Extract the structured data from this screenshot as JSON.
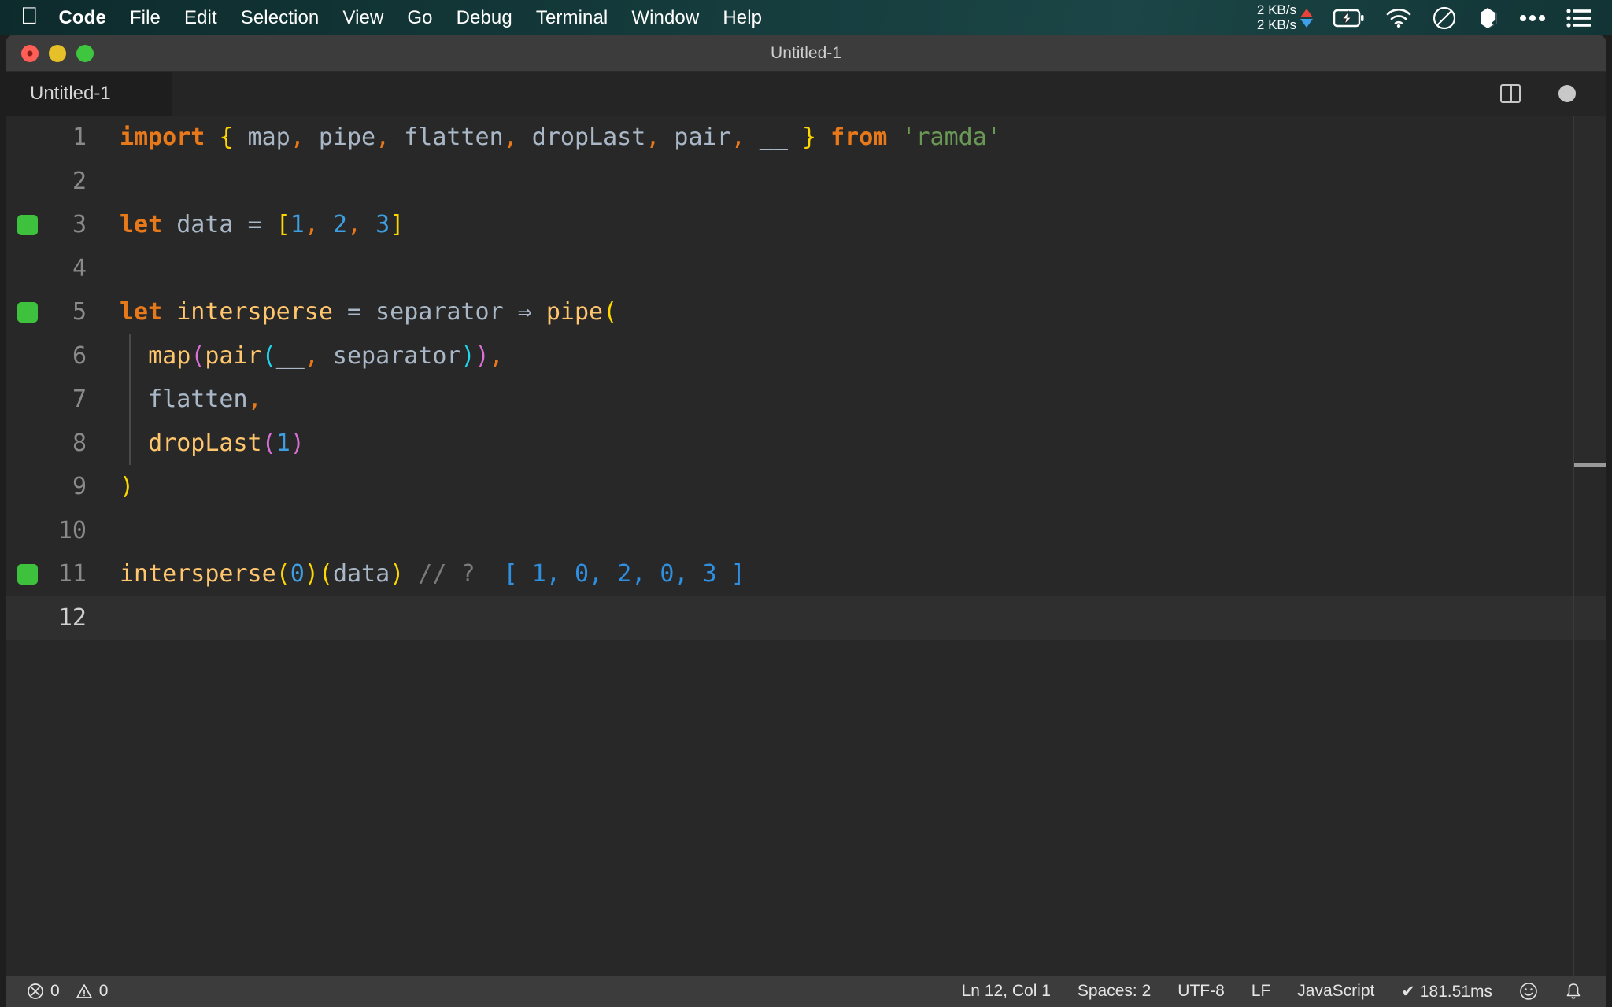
{
  "menubar": {
    "apple_icon": "apple-logo",
    "items": [
      {
        "label": "Code",
        "bold": true
      },
      {
        "label": "File"
      },
      {
        "label": "Edit"
      },
      {
        "label": "Selection"
      },
      {
        "label": "View"
      },
      {
        "label": "Go"
      },
      {
        "label": "Debug"
      },
      {
        "label": "Terminal"
      },
      {
        "label": "Window"
      },
      {
        "label": "Help"
      }
    ],
    "status": {
      "net_up": "2 KB/s",
      "net_down": "2 KB/s",
      "icons": [
        "battery-charging-icon",
        "wifi-icon",
        "do-not-disturb-icon",
        "dropbox-icon",
        "ellipsis-icon",
        "control-center-list-icon"
      ]
    }
  },
  "window": {
    "title": "Untitled-1",
    "traffic_lights": [
      "close-button",
      "minimize-button",
      "maximize-button"
    ]
  },
  "tabs": [
    {
      "label": "Untitled-1",
      "active": true
    }
  ],
  "editor_actions": {
    "split_label": "split-editor",
    "dirty_label": "unsaved-indicator"
  },
  "editor": {
    "lines": [
      {
        "num": "1",
        "marker": false,
        "indent": false,
        "tokens": [
          {
            "text": "import",
            "cls": "t-kw"
          },
          {
            "text": " ",
            "cls": "t-plain"
          },
          {
            "text": "{",
            "cls": "t-br1"
          },
          {
            "text": " map",
            "cls": "t-var"
          },
          {
            "text": ",",
            "cls": "t-comma"
          },
          {
            "text": " pipe",
            "cls": "t-var"
          },
          {
            "text": ",",
            "cls": "t-comma"
          },
          {
            "text": " flatten",
            "cls": "t-var"
          },
          {
            "text": ",",
            "cls": "t-comma"
          },
          {
            "text": " dropLast",
            "cls": "t-var"
          },
          {
            "text": ",",
            "cls": "t-comma"
          },
          {
            "text": " pair",
            "cls": "t-var"
          },
          {
            "text": ",",
            "cls": "t-comma"
          },
          {
            "text": " __ ",
            "cls": "t-var"
          },
          {
            "text": "}",
            "cls": "t-br1"
          },
          {
            "text": " ",
            "cls": "t-plain"
          },
          {
            "text": "from",
            "cls": "t-kw"
          },
          {
            "text": " ",
            "cls": "t-plain"
          },
          {
            "text": "'ramda'",
            "cls": "t-string"
          }
        ]
      },
      {
        "num": "2",
        "marker": false,
        "indent": false,
        "tokens": []
      },
      {
        "num": "3",
        "marker": true,
        "indent": false,
        "tokens": [
          {
            "text": "let",
            "cls": "t-kw"
          },
          {
            "text": " data ",
            "cls": "t-var"
          },
          {
            "text": "=",
            "cls": "t-punc"
          },
          {
            "text": " ",
            "cls": "t-plain"
          },
          {
            "text": "[",
            "cls": "t-br1"
          },
          {
            "text": "1",
            "cls": "t-num"
          },
          {
            "text": ",",
            "cls": "t-comma"
          },
          {
            "text": " ",
            "cls": "t-plain"
          },
          {
            "text": "2",
            "cls": "t-num"
          },
          {
            "text": ",",
            "cls": "t-comma"
          },
          {
            "text": " ",
            "cls": "t-plain"
          },
          {
            "text": "3",
            "cls": "t-num"
          },
          {
            "text": "]",
            "cls": "t-br1"
          }
        ]
      },
      {
        "num": "4",
        "marker": false,
        "indent": false,
        "tokens": []
      },
      {
        "num": "5",
        "marker": true,
        "indent": false,
        "tokens": [
          {
            "text": "let",
            "cls": "t-kw"
          },
          {
            "text": " ",
            "cls": "t-plain"
          },
          {
            "text": "intersperse",
            "cls": "t-fn"
          },
          {
            "text": " ",
            "cls": "t-plain"
          },
          {
            "text": "=",
            "cls": "t-punc"
          },
          {
            "text": " separator ",
            "cls": "t-var"
          },
          {
            "text": "⇒",
            "cls": "t-arrow"
          },
          {
            "text": " ",
            "cls": "t-plain"
          },
          {
            "text": "pipe",
            "cls": "t-fn"
          },
          {
            "text": "(",
            "cls": "t-br1"
          }
        ]
      },
      {
        "num": "6",
        "marker": false,
        "indent": true,
        "tokens": [
          {
            "text": "  ",
            "cls": "t-plain"
          },
          {
            "text": "map",
            "cls": "t-fn"
          },
          {
            "text": "(",
            "cls": "t-br2"
          },
          {
            "text": "pair",
            "cls": "t-fn"
          },
          {
            "text": "(",
            "cls": "t-br3"
          },
          {
            "text": "__",
            "cls": "t-var"
          },
          {
            "text": ",",
            "cls": "t-comma"
          },
          {
            "text": " separator",
            "cls": "t-var"
          },
          {
            "text": ")",
            "cls": "t-br3"
          },
          {
            "text": ")",
            "cls": "t-br2"
          },
          {
            "text": ",",
            "cls": "t-comma"
          }
        ]
      },
      {
        "num": "7",
        "marker": false,
        "indent": true,
        "tokens": [
          {
            "text": "  ",
            "cls": "t-plain"
          },
          {
            "text": "flatten",
            "cls": "t-var"
          },
          {
            "text": ",",
            "cls": "t-comma"
          }
        ]
      },
      {
        "num": "8",
        "marker": false,
        "indent": true,
        "tokens": [
          {
            "text": "  ",
            "cls": "t-plain"
          },
          {
            "text": "dropLast",
            "cls": "t-fn"
          },
          {
            "text": "(",
            "cls": "t-br2"
          },
          {
            "text": "1",
            "cls": "t-num"
          },
          {
            "text": ")",
            "cls": "t-br2"
          }
        ]
      },
      {
        "num": "9",
        "marker": false,
        "indent": false,
        "tokens": [
          {
            "text": ")",
            "cls": "t-br1"
          }
        ]
      },
      {
        "num": "10",
        "marker": false,
        "indent": false,
        "tokens": []
      },
      {
        "num": "11",
        "marker": true,
        "indent": false,
        "tokens": [
          {
            "text": "intersperse",
            "cls": "t-fn"
          },
          {
            "text": "(",
            "cls": "t-br1"
          },
          {
            "text": "0",
            "cls": "t-num"
          },
          {
            "text": ")",
            "cls": "t-br1"
          },
          {
            "text": "(",
            "cls": "t-br1"
          },
          {
            "text": "data",
            "cls": "t-var"
          },
          {
            "text": ")",
            "cls": "t-br1"
          },
          {
            "text": " // ?",
            "cls": "t-comment"
          },
          {
            "text": "  [ 1, 0, 2, 0, 3 ]",
            "cls": "t-result"
          }
        ]
      },
      {
        "num": "12",
        "marker": false,
        "indent": false,
        "current": true,
        "tokens": []
      }
    ]
  },
  "statusbar": {
    "errors": "0",
    "warnings": "0",
    "position": "Ln 12, Col 1",
    "indentation": "Spaces: 2",
    "encoding": "UTF-8",
    "eol": "LF",
    "language": "JavaScript",
    "quokka_time": "✔ 181.51ms",
    "feedback_icon": "smiley-icon",
    "notifications_icon": "bell-icon"
  },
  "colors": {
    "menubar_accent": "#14393a",
    "editor_bg": "#282828",
    "marker_green": "#3ec23e",
    "result_blue": "#2f8fe0"
  }
}
